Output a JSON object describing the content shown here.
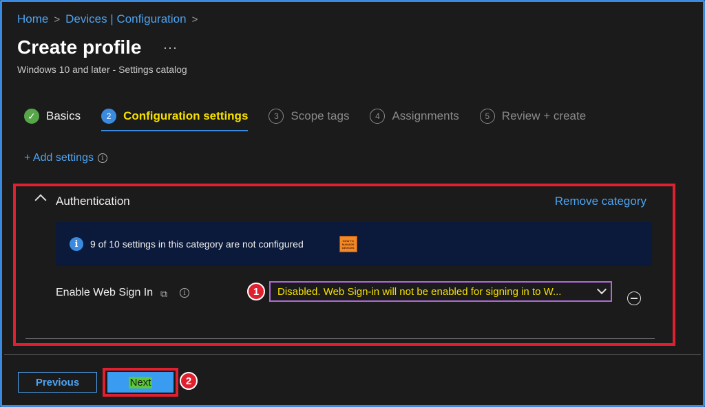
{
  "breadcrumb": {
    "items": [
      "Home",
      "Devices | Configuration"
    ],
    "separator": ">"
  },
  "page": {
    "title": "Create profile",
    "more": "···",
    "subtitle": "Windows 10 and later - Settings catalog"
  },
  "steps": [
    {
      "number": "✓",
      "label": "Basics",
      "state": "done"
    },
    {
      "number": "2",
      "label": "Configuration settings",
      "state": "active"
    },
    {
      "number": "3",
      "label": "Scope tags",
      "state": "pending"
    },
    {
      "number": "4",
      "label": "Assignments",
      "state": "pending"
    },
    {
      "number": "5",
      "label": "Review + create",
      "state": "pending"
    }
  ],
  "add_settings": {
    "label": "+ Add settings",
    "info": "i"
  },
  "category": {
    "title": "Authentication",
    "remove_label": "Remove category",
    "banner": {
      "info": "i",
      "text": "9 of 10 settings in this category are not configured",
      "logo_lines": [
        "HOW TO",
        "MANAGE",
        "DEVICES"
      ]
    },
    "setting": {
      "label": "Enable Web Sign In",
      "copy_icon": "⧉",
      "info": "i",
      "value": "Disabled. Web Sign-in will not be enabled for signing in to W..."
    }
  },
  "callouts": {
    "one": "1",
    "two": "2"
  },
  "footer": {
    "previous_label": "Previous",
    "next_label": "Next"
  },
  "colors": {
    "accent": "#3a8be0",
    "highlight_text": "#f5e000",
    "callout_red": "#e0202e",
    "done_green": "#57a64a"
  }
}
